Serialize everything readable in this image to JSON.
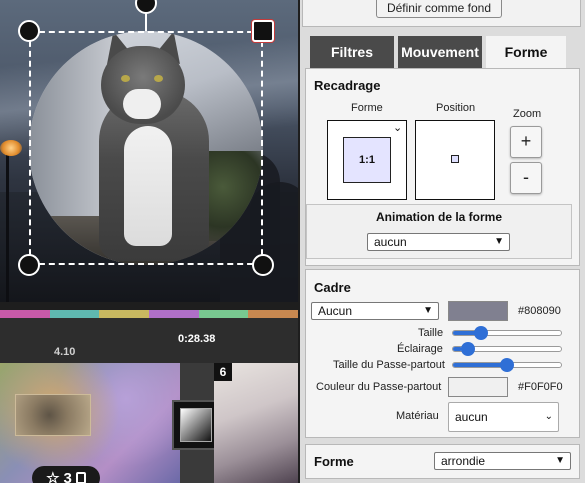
{
  "preview": {
    "timeline_colors": [
      "#c85aa8",
      "#5fb8b0",
      "#c8b860",
      "#b070c8",
      "#78c890",
      "#c88850"
    ]
  },
  "timeline": {
    "time_left": "4.10",
    "time_center": "0:28.38",
    "clip_badge_star": "☆",
    "clip_badge_count": "3",
    "clip_number": "6"
  },
  "toolbar": {
    "set_background": "Définir comme fond"
  },
  "tabs": [
    {
      "label": "Filtres",
      "active": false
    },
    {
      "label": "Mouvement",
      "active": false
    },
    {
      "label": "Forme",
      "active": true
    }
  ],
  "recadrage": {
    "title": "Recadrage",
    "forme_label": "Forme",
    "position_label": "Position",
    "zoom_label": "Zoom",
    "ratio": "1:1",
    "zoom_in": "+",
    "zoom_out": "-",
    "animation_title": "Animation de la forme",
    "animation_value": "aucun"
  },
  "cadre": {
    "title": "Cadre",
    "frame_value": "Aucun",
    "frame_color": "#808090",
    "frame_color_text": "#808090",
    "taille_label": "Taille",
    "taille_value": 0.22,
    "eclairage_label": "Éclairage",
    "eclairage_value": 0.08,
    "passe_partout_size_label": "Taille du Passe-partout",
    "passe_partout_size_value": 0.5,
    "passe_partout_color_label": "Couleur du Passe-partout",
    "passe_partout_color": "#F0F0F0",
    "passe_partout_color_text": "#F0F0F0",
    "materiau_label": "Matériau",
    "materiau_value": "aucun"
  },
  "forme": {
    "title": "Forme",
    "value": "arrondie"
  }
}
